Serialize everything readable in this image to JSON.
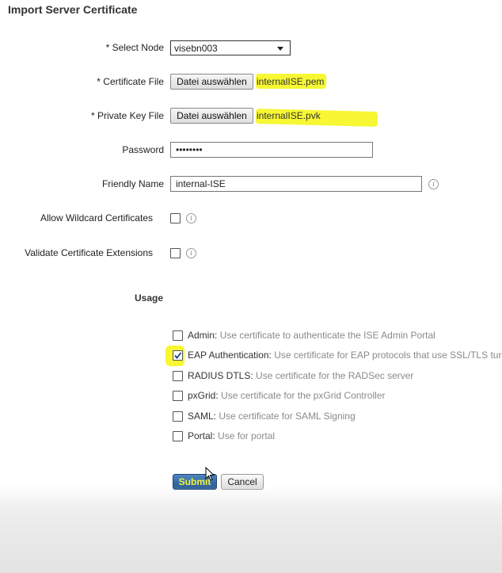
{
  "page": {
    "title": "Import Server Certificate"
  },
  "form": {
    "select_node": {
      "label": "* Select Node",
      "value": "visebn003"
    },
    "certificate_file": {
      "label": "* Certificate File",
      "button": "Datei auswählen",
      "filename": "internalISE.pem"
    },
    "private_key_file": {
      "label": "* Private Key File",
      "button": "Datei auswählen",
      "filename": "internalISE.pvk"
    },
    "password": {
      "label": "Password",
      "value": "••••••••"
    },
    "friendly_name": {
      "label": "Friendly Name",
      "value": "internal-ISE"
    },
    "allow_wildcard": {
      "label": "Allow Wildcard Certificates",
      "checked": false
    },
    "validate_extensions": {
      "label": "Validate Certificate Extensions",
      "checked": false
    }
  },
  "usage": {
    "heading": "Usage",
    "items": [
      {
        "name": "Admin:",
        "desc": "Use certificate to authenticate the ISE Admin Portal",
        "checked": false
      },
      {
        "name": "EAP Authentication:",
        "desc": "Use certificate for EAP protocols that use SSL/TLS tur",
        "checked": true
      },
      {
        "name": "RADIUS DTLS:",
        "desc": "Use certificate for the RADSec server",
        "checked": false
      },
      {
        "name": "pxGrid:",
        "desc": "Use certificate for the pxGrid Controller",
        "checked": false
      },
      {
        "name": "SAML:",
        "desc": "Use certificate for SAML Signing",
        "checked": false
      },
      {
        "name": "Portal:",
        "desc": "Use for portal",
        "checked": false
      }
    ]
  },
  "actions": {
    "submit": "Submit",
    "cancel": "Cancel"
  },
  "colors": {
    "highlight": "#f7f733",
    "submit_button": "#2f67a6",
    "description_text": "#8a8a8a"
  }
}
